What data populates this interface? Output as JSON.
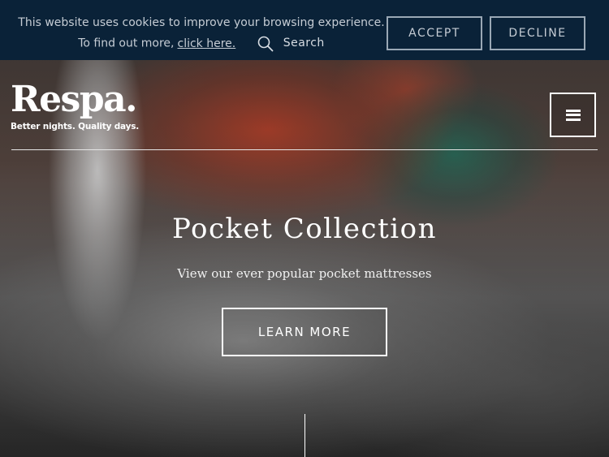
{
  "cookie_bar": {
    "message": "This website uses cookies to improve your browsing experience. To find out more,",
    "link_text": "click here.",
    "search_label": "Search",
    "accept_label": "ACCEPT",
    "decline_label": "DECLINE"
  },
  "header": {
    "logo_text": "Respa.",
    "tagline": "Better nights. Quality days.",
    "menu_icon": "hamburger-icon"
  },
  "hero": {
    "title": "Pocket Collection",
    "subtitle": "View our ever popular pocket mattresses",
    "cta_label": "LEARN MORE"
  },
  "colors": {
    "cookie_bar_bg": "#0a2238",
    "text_white": "#ffffff",
    "cookie_button_border": "#9aa8b5"
  }
}
